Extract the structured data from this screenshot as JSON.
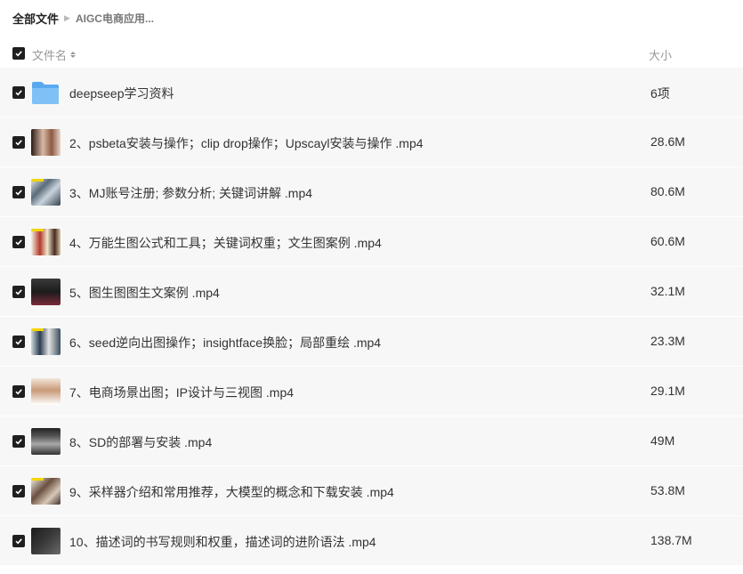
{
  "breadcrumb": {
    "root": "全部文件",
    "current": "AIGC电商应用..."
  },
  "header": {
    "name_label": "文件名",
    "size_label": "大小"
  },
  "files": [
    {
      "name": "deepseep学习资料",
      "size": "6项",
      "type": "folder",
      "icon": "folder-icon"
    },
    {
      "name": "2、psbeta安装与操作；clip drop操作；Upscayl安装与操作 .mp4",
      "size": "28.6M",
      "type": "video",
      "icon": "video-thumbnail"
    },
    {
      "name": "3、MJ账号注册; 参数分析; 关键词讲解 .mp4",
      "size": "80.6M",
      "type": "video",
      "icon": "video-thumbnail"
    },
    {
      "name": "4、万能生图公式和工具；关键词权重；文生图案例 .mp4",
      "size": "60.6M",
      "type": "video",
      "icon": "video-thumbnail"
    },
    {
      "name": "5、图生图图生文案例 .mp4",
      "size": "32.1M",
      "type": "video",
      "icon": "video-thumbnail"
    },
    {
      "name": "6、seed逆向出图操作；insightface换脸；局部重绘 .mp4",
      "size": "23.3M",
      "type": "video",
      "icon": "video-thumbnail"
    },
    {
      "name": "7、电商场景出图；IP设计与三视图 .mp4",
      "size": "29.1M",
      "type": "video",
      "icon": "video-thumbnail"
    },
    {
      "name": "8、SD的部署与安装 .mp4",
      "size": "49M",
      "type": "video",
      "icon": "video-thumbnail"
    },
    {
      "name": "9、采样器介绍和常用推荐，大模型的概念和下载安装 .mp4",
      "size": "53.8M",
      "type": "video",
      "icon": "video-thumbnail"
    },
    {
      "name": "10、描述词的书写规则和权重，描述词的进阶语法 .mp4",
      "size": "138.7M",
      "type": "video",
      "icon": "video-thumbnail"
    }
  ],
  "colors": {
    "row_background": "#f7f7f7",
    "checkbox": "#1f1f1f",
    "folder": "#5aa9f0"
  }
}
